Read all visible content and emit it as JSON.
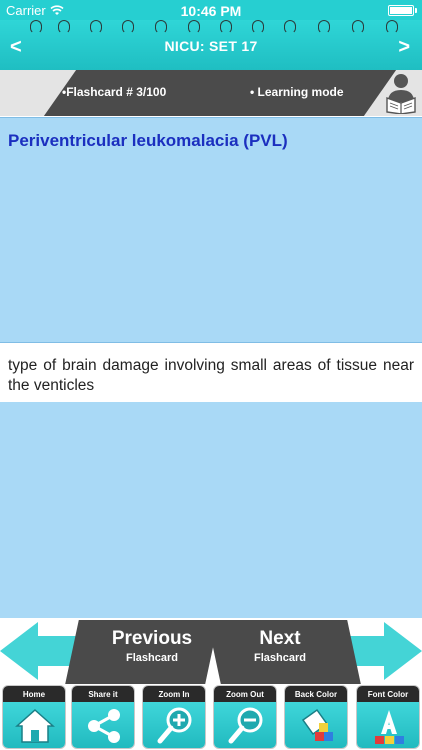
{
  "status_bar": {
    "carrier": "Carrier",
    "time": "10:46 PM"
  },
  "nav": {
    "title": "NICU: SET 17",
    "back_glyph": "<",
    "forward_glyph": ">"
  },
  "info": {
    "flashcard_label": "•Flashcard #  3/100",
    "mode_label": "• Learning mode"
  },
  "card": {
    "question": "Periventricular leukomalacia (PVL)",
    "answer": "type of brain damage involving small areas of tissue near the venticles"
  },
  "buttons": {
    "previous_main": "Previous",
    "previous_sub": "Flashcard",
    "next_main": "Next",
    "next_sub": "Flashcard"
  },
  "toolbar": {
    "items": [
      {
        "label": "Home",
        "icon": "home-icon"
      },
      {
        "label": "Share it",
        "icon": "share-icon"
      },
      {
        "label": "Zoom In",
        "icon": "zoom-in-icon"
      },
      {
        "label": "Zoom Out",
        "icon": "zoom-out-icon"
      },
      {
        "label": "Back Color",
        "icon": "paint-bucket-icon"
      },
      {
        "label": "Font Color",
        "icon": "font-color-icon"
      }
    ]
  },
  "colors": {
    "accent": "#26cfd1",
    "card_background": "#a9d9f6",
    "question_text": "#1b2fbf",
    "band_dark": "#4b4b4b"
  }
}
